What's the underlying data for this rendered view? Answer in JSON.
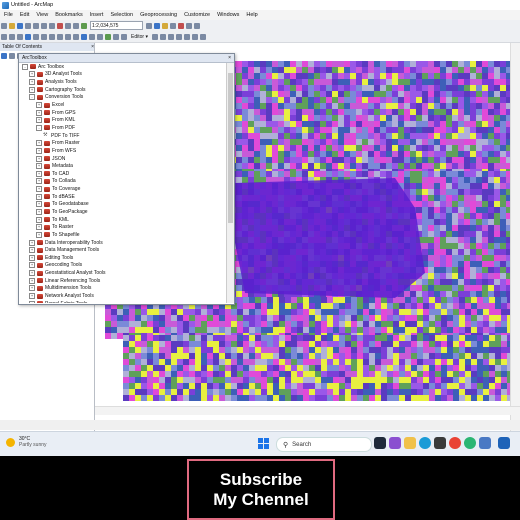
{
  "window": {
    "title": "Untitled - ArcMap"
  },
  "menu": [
    "File",
    "Edit",
    "View",
    "Bookmarks",
    "Insert",
    "Selection",
    "Geoprocessing",
    "Customize",
    "Windows",
    "Help"
  ],
  "toolbar": {
    "scale": "1:2,034,575",
    "editor_label": "Editor ▾"
  },
  "toc": {
    "title": "Table Of Contents"
  },
  "toolbox": {
    "title": "ArcToolbox",
    "items": [
      {
        "label": "Arc Toolbox",
        "level": 0,
        "kind": "root",
        "state": "-"
      },
      {
        "label": "3D Analyst Tools",
        "level": 1,
        "kind": "toolbox",
        "state": "+"
      },
      {
        "label": "Analysis Tools",
        "level": 1,
        "kind": "toolbox",
        "state": "+"
      },
      {
        "label": "Cartography Tools",
        "level": 1,
        "kind": "toolbox",
        "state": "+"
      },
      {
        "label": "Conversion Tools",
        "level": 1,
        "kind": "toolbox",
        "state": "-"
      },
      {
        "label": "Excel",
        "level": 2,
        "kind": "toolbox",
        "state": "+"
      },
      {
        "label": "From GPS",
        "level": 2,
        "kind": "toolbox",
        "state": "+"
      },
      {
        "label": "From KML",
        "level": 2,
        "kind": "toolbox",
        "state": "+"
      },
      {
        "label": "From PDF",
        "level": 2,
        "kind": "toolbox",
        "state": "-"
      },
      {
        "label": "PDF To TIFF",
        "level": 3,
        "kind": "tool",
        "state": ""
      },
      {
        "label": "From Raster",
        "level": 2,
        "kind": "toolbox",
        "state": "+"
      },
      {
        "label": "From WFS",
        "level": 2,
        "kind": "toolbox",
        "state": "+"
      },
      {
        "label": "JSON",
        "level": 2,
        "kind": "toolbox",
        "state": "+"
      },
      {
        "label": "Metadata",
        "level": 2,
        "kind": "toolbox",
        "state": "+"
      },
      {
        "label": "To CAD",
        "level": 2,
        "kind": "toolbox",
        "state": "+"
      },
      {
        "label": "To Collada",
        "level": 2,
        "kind": "toolbox",
        "state": "+"
      },
      {
        "label": "To Coverage",
        "level": 2,
        "kind": "toolbox",
        "state": "+"
      },
      {
        "label": "To dBASE",
        "level": 2,
        "kind": "toolbox",
        "state": "+"
      },
      {
        "label": "To Geodatabase",
        "level": 2,
        "kind": "toolbox",
        "state": "+"
      },
      {
        "label": "To GeoPackage",
        "level": 2,
        "kind": "toolbox",
        "state": "+"
      },
      {
        "label": "To KML",
        "level": 2,
        "kind": "toolbox",
        "state": "+"
      },
      {
        "label": "To Raster",
        "level": 2,
        "kind": "toolbox",
        "state": "+"
      },
      {
        "label": "To Shapefile",
        "level": 2,
        "kind": "toolbox",
        "state": "+"
      },
      {
        "label": "Data Interoperability Tools",
        "level": 1,
        "kind": "toolbox",
        "state": "+"
      },
      {
        "label": "Data Management Tools",
        "level": 1,
        "kind": "toolbox",
        "state": "+"
      },
      {
        "label": "Editing Tools",
        "level": 1,
        "kind": "toolbox",
        "state": "+"
      },
      {
        "label": "Geocoding Tools",
        "level": 1,
        "kind": "toolbox",
        "state": "+"
      },
      {
        "label": "Geostatistical Analyst Tools",
        "level": 1,
        "kind": "toolbox",
        "state": "+"
      },
      {
        "label": "Linear Referencing Tools",
        "level": 1,
        "kind": "toolbox",
        "state": "+"
      },
      {
        "label": "Multidimension Tools",
        "level": 1,
        "kind": "toolbox",
        "state": "+"
      },
      {
        "label": "Network Analyst Tools",
        "level": 1,
        "kind": "toolbox",
        "state": "+"
      },
      {
        "label": "Parcel Fabric Tools",
        "level": 1,
        "kind": "toolbox",
        "state": "+"
      }
    ]
  },
  "taskbar": {
    "weather_temp": "30°C",
    "weather_desc": "Partly sunny",
    "search_placeholder": "Search"
  },
  "overlay": {
    "line1": "Subscribe",
    "line2": "My Chennel"
  },
  "colors": {
    "overlay_border": "#e06a80",
    "raster_purple": "#7b3fd8",
    "raster_pink": "#e04ad8",
    "raster_yellow": "#e8f040"
  }
}
